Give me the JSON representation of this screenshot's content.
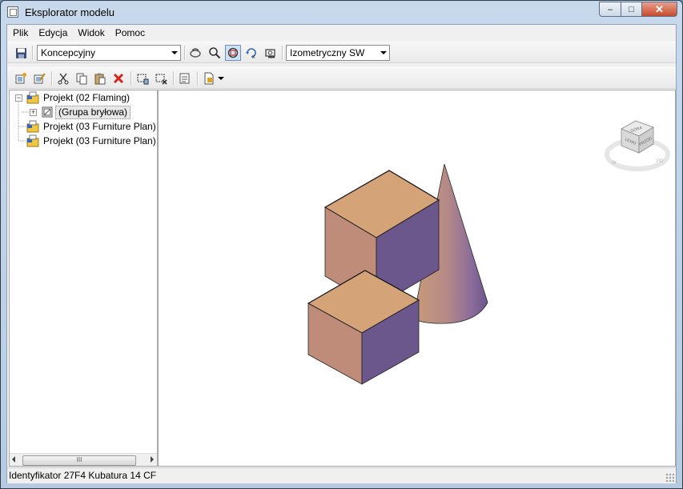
{
  "window": {
    "title": "Eksplorator modelu",
    "buttons": {
      "minimize": "–",
      "maximize": "□",
      "close": "✕"
    }
  },
  "menu": [
    {
      "label": "Plik"
    },
    {
      "label": "Edycja"
    },
    {
      "label": "Widok"
    },
    {
      "label": "Pomoc"
    }
  ],
  "toolbar": {
    "visual_style": "Koncepcyjny",
    "view_preset": "Izometryczny SW"
  },
  "tree": [
    {
      "label": "Projekt (02 Flaming)",
      "expander": "−",
      "level": 0
    },
    {
      "label": "(Grupa bryłowa)",
      "expander": "+",
      "level": 1,
      "selected": true
    },
    {
      "label": "Projekt (03 Furniture Plan)",
      "expander": "",
      "level": 0
    },
    {
      "label": "Projekt (03 Furniture Plan)",
      "expander": "",
      "level": 0
    }
  ],
  "tree_scrollbar": {
    "thumb_label": "III"
  },
  "viewcube": {
    "top": "GÓRA",
    "left": "LEWO",
    "front": "PRZÓD",
    "compass_w": "W",
    "compass_s": "PD"
  },
  "status": "Identyfikator 27F4  Kubatura 14 CF",
  "colors": {
    "face_top": "#d4a478",
    "face_front": "#be8c78",
    "face_side": "#6b578c"
  }
}
